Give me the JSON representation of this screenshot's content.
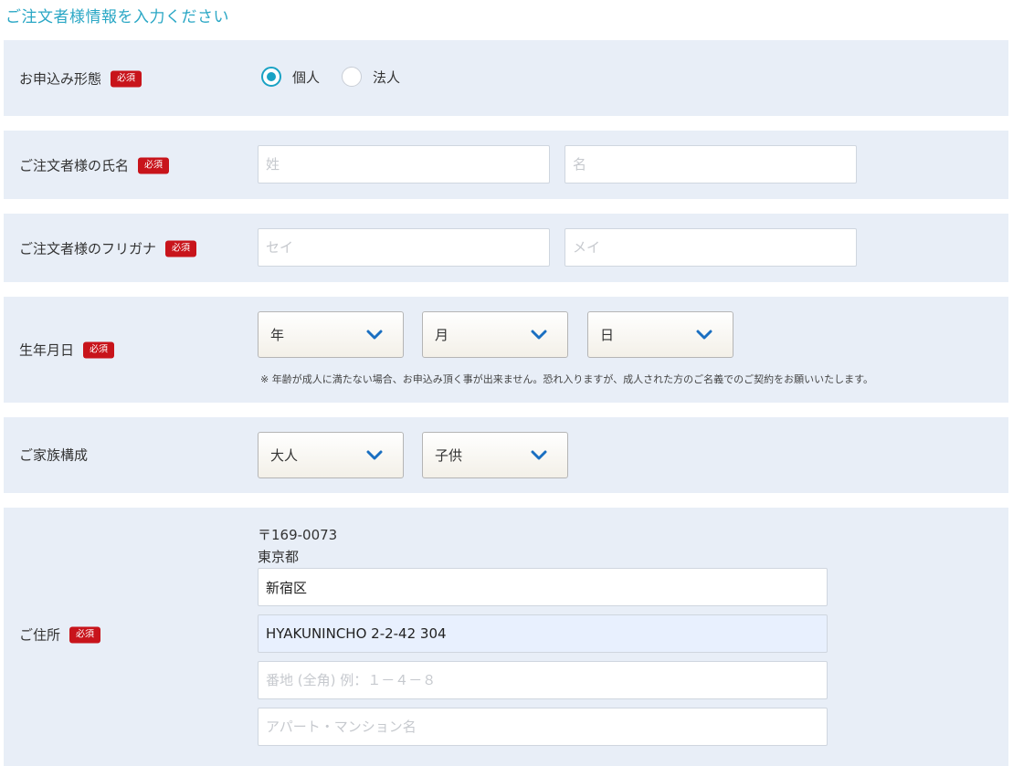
{
  "page_title": "ご注文者様情報を入力ください",
  "required_badge": "必須",
  "colors": {
    "accent": "#19a2c4",
    "badge": "#c8141b",
    "section_bg": "#e8eef7"
  },
  "application_type": {
    "label": "お申込み形態",
    "options": [
      {
        "label": "個人",
        "checked": true
      },
      {
        "label": "法人",
        "checked": false
      }
    ]
  },
  "name": {
    "label": "ご注文者様の氏名",
    "last_placeholder": "姓",
    "first_placeholder": "名"
  },
  "furigana": {
    "label": "ご注文者様のフリガナ",
    "last_placeholder": "セイ",
    "first_placeholder": "メイ"
  },
  "birthdate": {
    "label": "生年月日",
    "year": "年",
    "month": "月",
    "day": "日",
    "note": "※ 年齢が成人に満たない場合、お申込み頂く事が出来ません。恐れ入りますが、成人された方のご名義でのご契約をお願いいたします。"
  },
  "family": {
    "label": "ご家族構成",
    "adults": "大人",
    "children": "子供"
  },
  "address": {
    "label": "ご住所",
    "postal": "〒169-0073",
    "prefecture": "東京都",
    "city_value": "新宿区",
    "street_value": "HYAKUNINCHO 2-2-42 304",
    "block_placeholder": "番地 (全角) 例：１－４－８",
    "building_placeholder": "アパート・マンション名"
  },
  "icons": {
    "select_arrow": "chevron-down-icon"
  }
}
